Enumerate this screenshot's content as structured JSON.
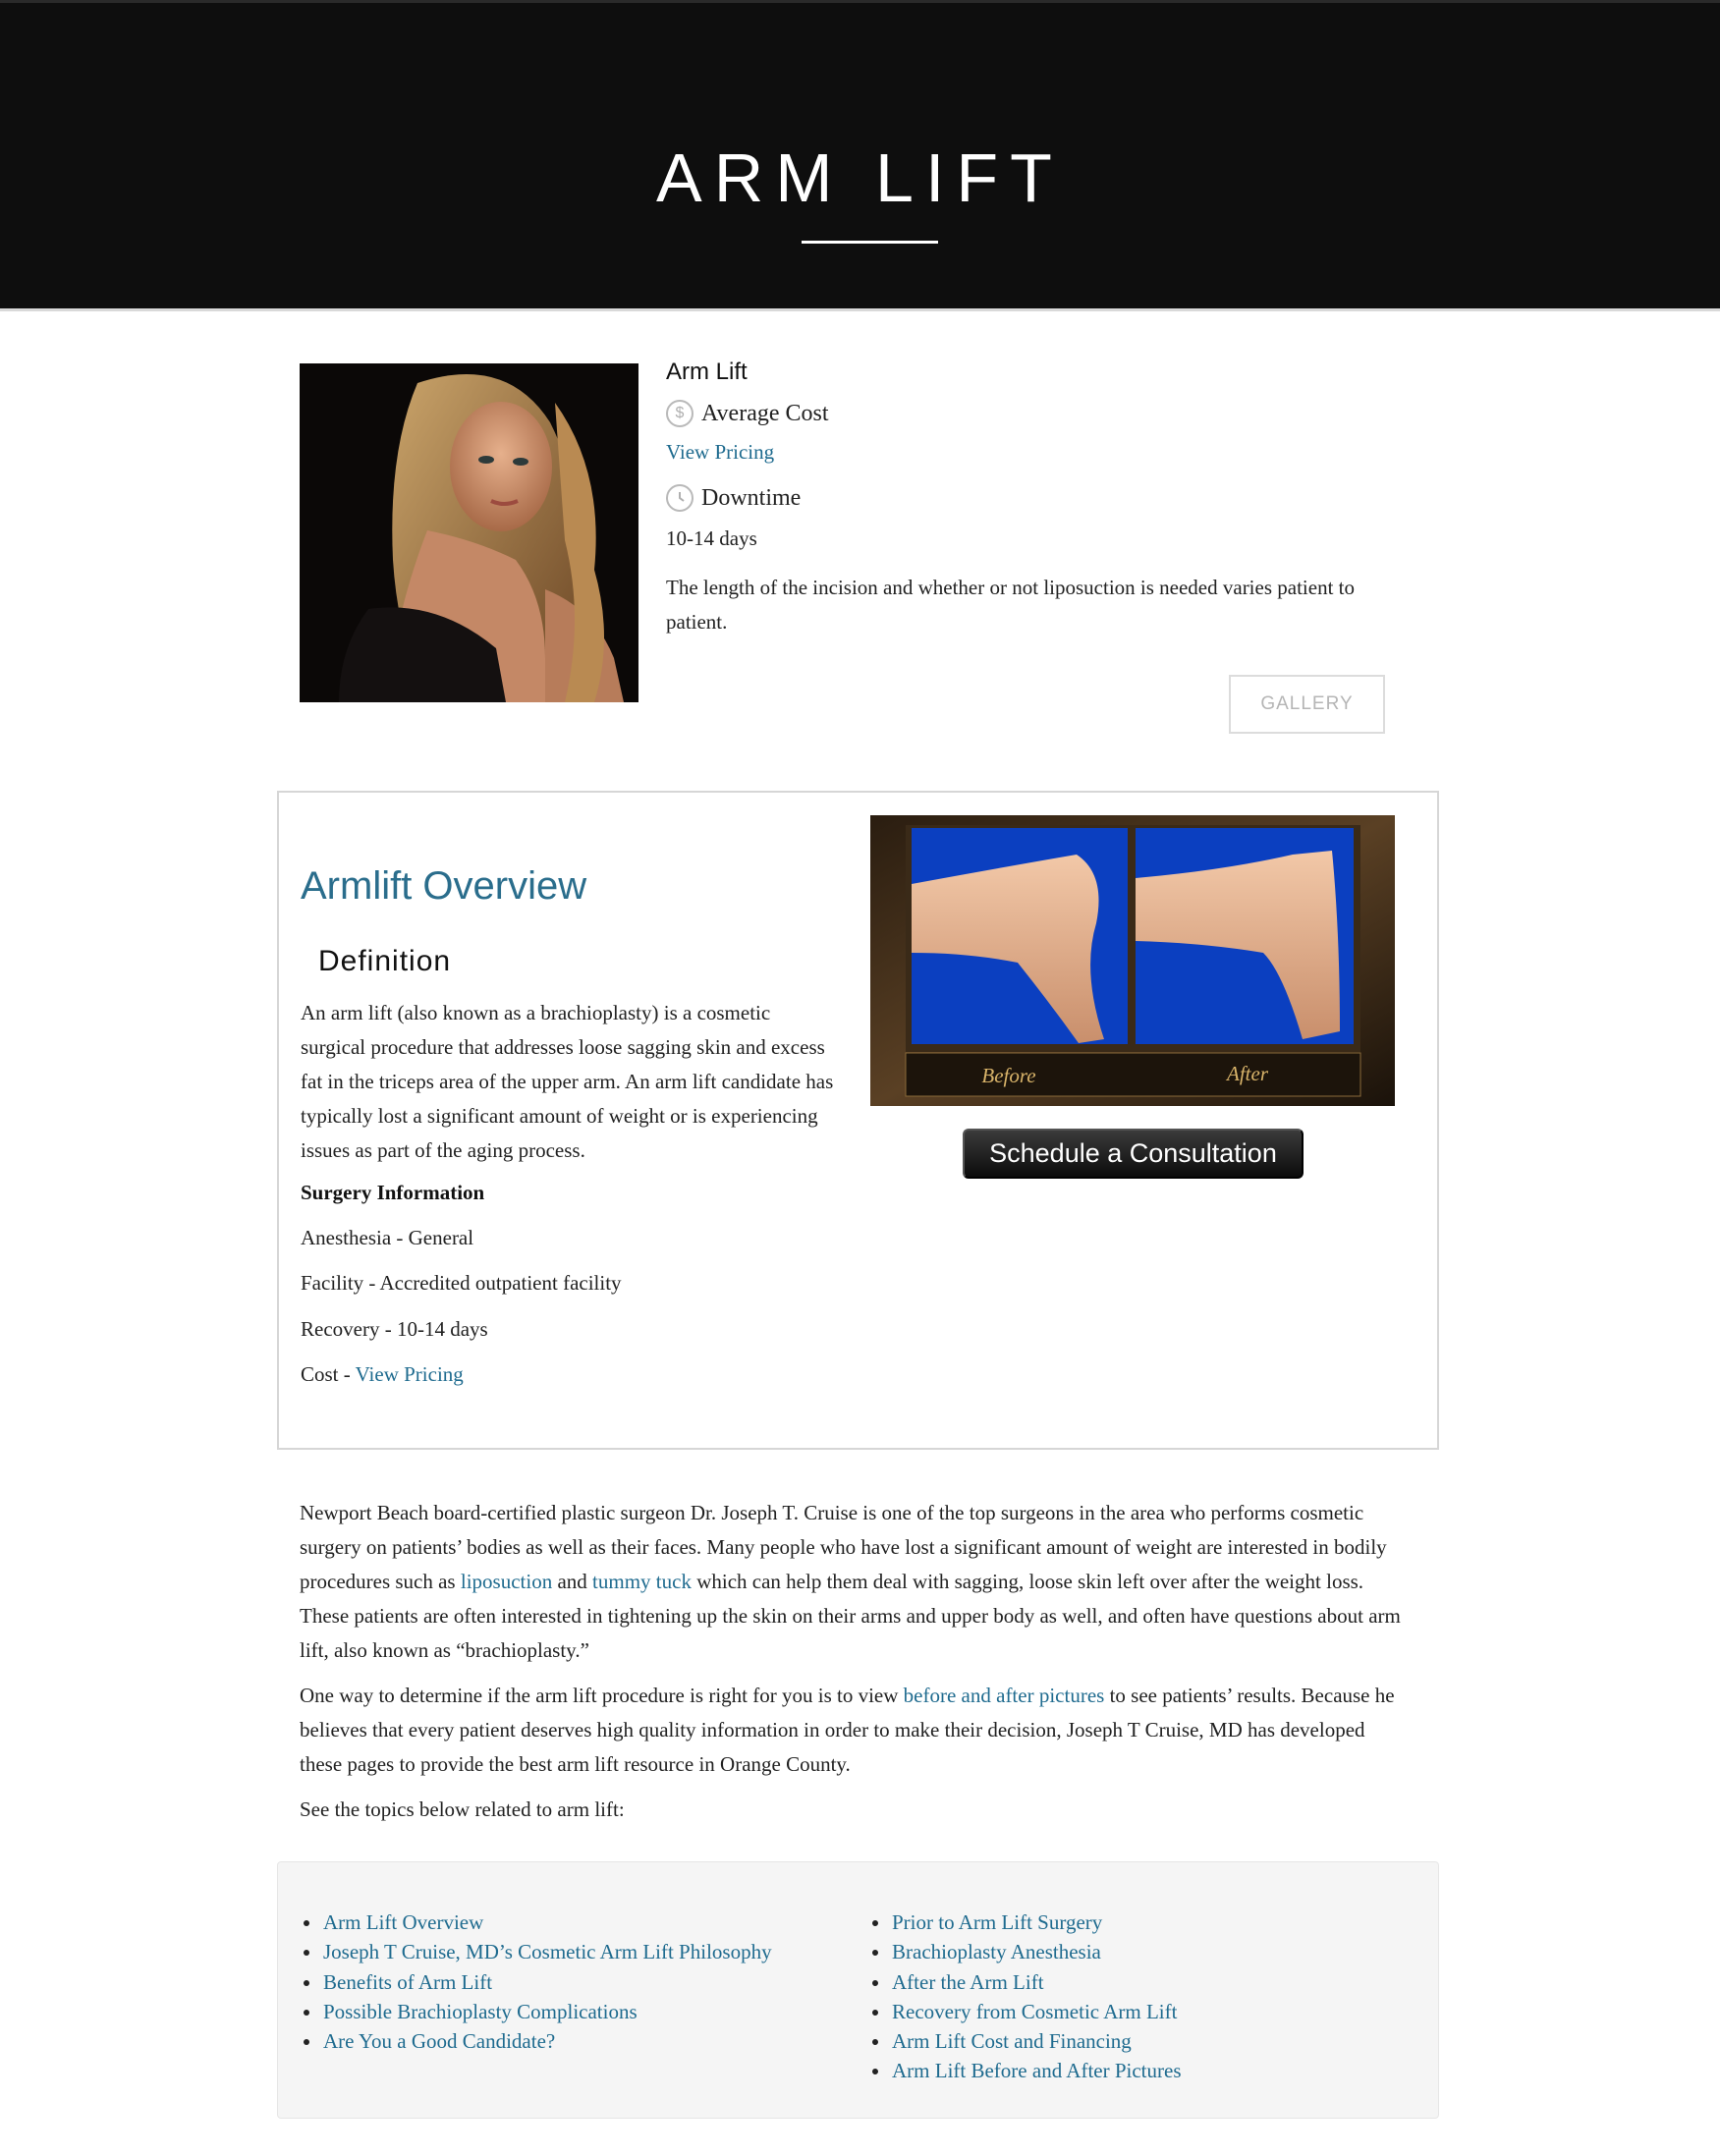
{
  "hero": {
    "title": "ARM LIFT"
  },
  "intro": {
    "procedure_name": "Arm Lift",
    "average_cost_label": "Average Cost",
    "cost_icon_symbol": "$",
    "view_pricing": "View Pricing",
    "downtime_label": "Downtime",
    "downtime_value": "10-14 days",
    "description": "The length of the incision and whether or not liposuction is needed varies patient to patient.",
    "gallery_button": "GALLERY"
  },
  "overview": {
    "title": "Armlift Overview",
    "definition_heading": "Definition",
    "definition_text": "An arm lift (also known as a brachioplasty) is a cosmetic surgical procedure that addresses loose sagging skin and excess fat in the triceps area of the upper arm. An arm lift candidate has typically lost a significant amount of weight or is experiencing issues as part of the aging process.",
    "surgery_info_heading": "Surgery Information",
    "anesthesia": "Anesthesia - General",
    "facility": "Facility - Accredited outpatient facility",
    "recovery": "Recovery - 10-14 days",
    "cost_label": "Cost - ",
    "cost_link": "View Pricing",
    "before_label": "Before",
    "after_label": "After",
    "consult_button": "Schedule a Consultation"
  },
  "body": {
    "p1_a": "Newport Beach board-certified plastic surgeon Dr. Joseph T. Cruise is one of the top surgeons in the area who performs cosmetic surgery on patients’ bodies as well as their faces. Many people who have lost a significant amount of weight are interested in bodily procedures such as ",
    "p1_link1": "liposuction",
    "p1_b": " and ",
    "p1_link2": "tummy tuck",
    "p1_c": " which can help them deal with sagging, loose skin left over after the weight loss. These patients are often interested in tightening up the skin on their arms and upper body as well, and often have questions about arm lift, also known as “brachioplasty.”",
    "p2_a": "One way to determine if the arm lift procedure is right for you is to view ",
    "p2_link": "before and after pictures",
    "p2_b": " to see patients’ results. Because he believes that every patient deserves high quality information in order to make their decision, Joseph T Cruise, MD has developed these pages to provide the best arm lift resource in Orange County.",
    "p3": "See the topics below related to arm lift:"
  },
  "topics": {
    "left": [
      "Arm Lift Overview",
      "Joseph T Cruise, MD’s Cosmetic Arm Lift Philosophy",
      "Benefits of Arm Lift",
      "Possible Brachioplasty Complications",
      "Are You a Good Candidate?"
    ],
    "right": [
      "Prior to Arm Lift Surgery",
      "Brachioplasty Anesthesia",
      "After the Arm Lift",
      "Recovery from Cosmetic Arm Lift",
      "Arm Lift Cost and Financing",
      "Arm Lift Before and After Pictures"
    ]
  },
  "colors": {
    "link": "#1f6b8f",
    "hero_bg": "#0e0e0e",
    "ba_blue": "#0b3fc0"
  }
}
